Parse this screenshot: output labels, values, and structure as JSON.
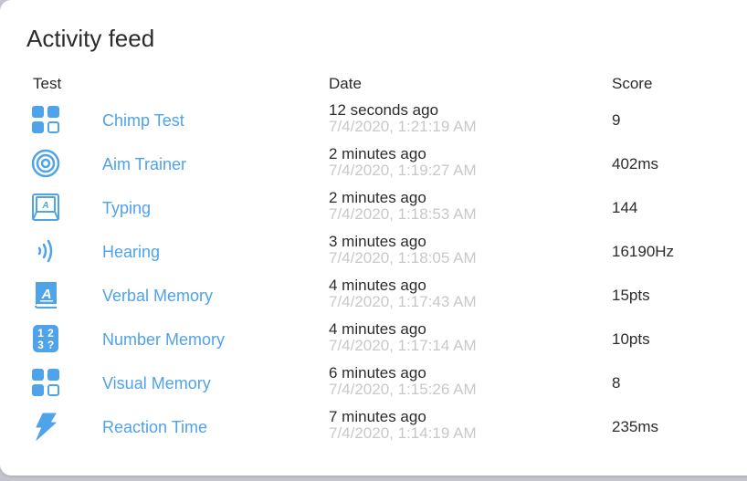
{
  "card": {
    "title": "Activity feed"
  },
  "table": {
    "headers": {
      "test": "Test",
      "date": "Date",
      "score": "Score"
    },
    "accent_color": "#4fa3e8",
    "rows": [
      {
        "icon": "chimp-grid-icon",
        "test": "Chimp Test",
        "relative": "12 seconds ago",
        "timestamp": "7/4/2020, 1:21:19 AM",
        "score": "9"
      },
      {
        "icon": "target-icon",
        "test": "Aim Trainer",
        "relative": "2 minutes ago",
        "timestamp": "7/4/2020, 1:19:27 AM",
        "score": "402ms"
      },
      {
        "icon": "keyboard-key-icon",
        "test": "Typing",
        "relative": "2 minutes ago",
        "timestamp": "7/4/2020, 1:18:53 AM",
        "score": "144"
      },
      {
        "icon": "sound-waves-icon",
        "test": "Hearing",
        "relative": "3 minutes ago",
        "timestamp": "7/4/2020, 1:18:05 AM",
        "score": "16190Hz"
      },
      {
        "icon": "book-icon",
        "test": "Verbal Memory",
        "relative": "4 minutes ago",
        "timestamp": "7/4/2020, 1:17:43 AM",
        "score": "15pts"
      },
      {
        "icon": "numbers-icon",
        "test": "Number Memory",
        "relative": "4 minutes ago",
        "timestamp": "7/4/2020, 1:17:14 AM",
        "score": "10pts"
      },
      {
        "icon": "visual-grid-icon",
        "test": "Visual Memory",
        "relative": "6 minutes ago",
        "timestamp": "7/4/2020, 1:15:26 AM",
        "score": "8"
      },
      {
        "icon": "lightning-icon",
        "test": "Reaction Time",
        "relative": "7 minutes ago",
        "timestamp": "7/4/2020, 1:14:19 AM",
        "score": "235ms"
      }
    ]
  }
}
